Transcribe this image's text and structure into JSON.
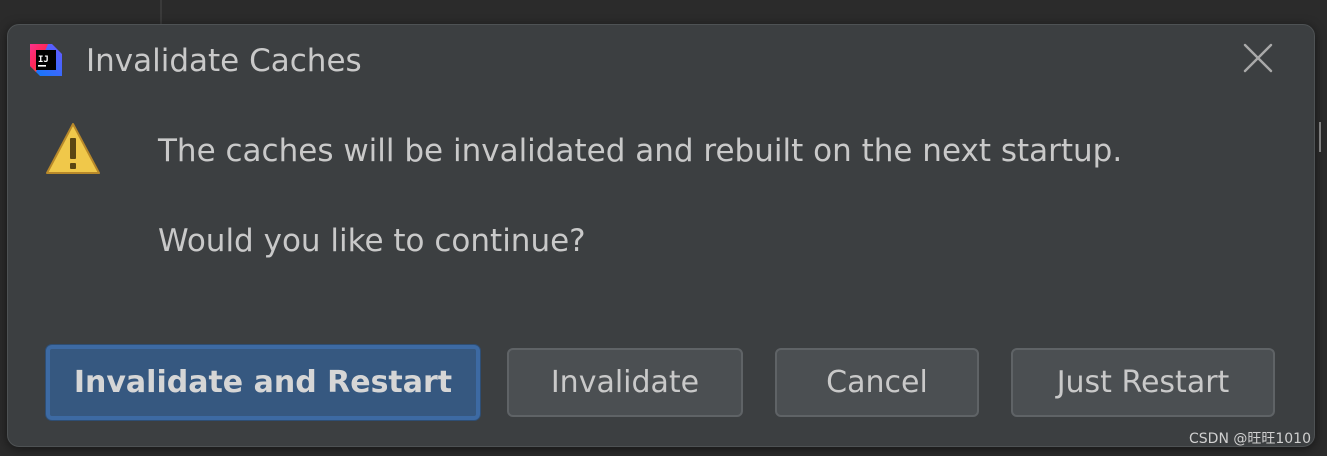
{
  "dialog": {
    "title": "Invalidate Caches",
    "app_icon": "intellij-idea-icon",
    "close_icon": "close-icon",
    "warning_icon": "warning-triangle-icon",
    "message": "The caches will be invalidated and rebuilt on the next startup.",
    "question": "Would you like to continue?"
  },
  "buttons": {
    "invalidate_and_restart": "Invalidate and Restart",
    "invalidate": "Invalidate",
    "cancel": "Cancel",
    "just_restart": "Just Restart"
  },
  "watermark": "CSDN @旺旺1010",
  "colors": {
    "dialog_bg": "#3c3f41",
    "primary_button": "#365880",
    "text": "#c9c9c9",
    "warning": "#f0c84a"
  }
}
